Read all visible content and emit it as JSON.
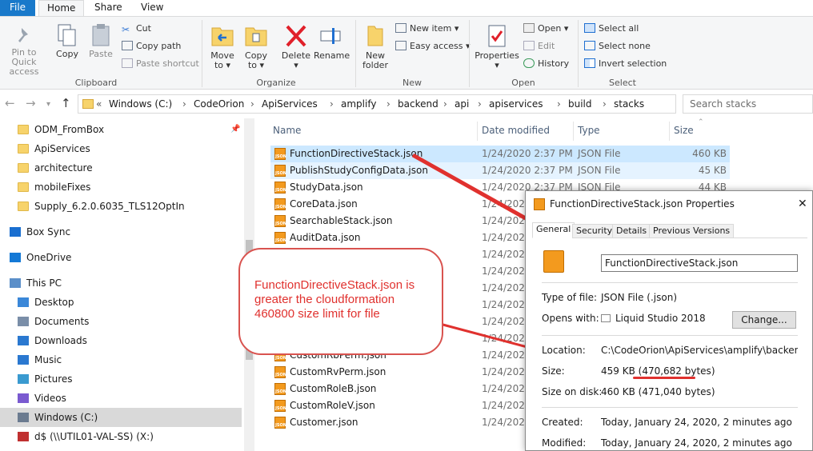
{
  "tabs": {
    "file": "File",
    "home": "Home",
    "share": "Share",
    "view": "View"
  },
  "ribbon": {
    "pin": "Pin to Quick access",
    "copy": "Copy",
    "paste": "Paste",
    "cut": "Cut",
    "copy_path": "Copy path",
    "paste_shortcut": "Paste shortcut",
    "move_to": "Move to ▾",
    "copy_to": "Copy to ▾",
    "delete": "Delete ▾",
    "rename": "Rename",
    "new_folder": "New folder",
    "new_item": "New item ▾",
    "easy_access": "Easy access ▾",
    "properties": "Properties ▾",
    "open": "Open ▾",
    "edit": "Edit",
    "history": "History",
    "select_all": "Select all",
    "select_none": "Select none",
    "invert_selection": "Invert selection",
    "groups": {
      "clipboard": "Clipboard",
      "organize": "Organize",
      "new": "New",
      "open": "Open",
      "select": "Select"
    }
  },
  "address": {
    "prefix": "«",
    "crumbs": [
      "Windows (C:)",
      "CodeOrion",
      "ApiServices",
      "amplify",
      "backend",
      "api",
      "apiservices",
      "build",
      "stacks"
    ],
    "search_placeholder": "Search stacks"
  },
  "nav": {
    "items": [
      {
        "label": "ODM_FromBox",
        "icon": "folder-icon"
      },
      {
        "label": "ApiServices",
        "icon": "folder-icon"
      },
      {
        "label": "architecture",
        "icon": "folder-icon"
      },
      {
        "label": "mobileFixes",
        "icon": "folder-icon"
      },
      {
        "label": "Supply_6.2.0.6035_TLS12OptIn",
        "icon": "folder-icon"
      },
      {
        "label": "Box Sync",
        "icon": "box-icon"
      },
      {
        "label": "OneDrive",
        "icon": "cloud-icon"
      },
      {
        "label": "This PC",
        "icon": "computer-icon"
      },
      {
        "label": "Desktop",
        "icon": "desktop-icon"
      },
      {
        "label": "Documents",
        "icon": "documents-icon"
      },
      {
        "label": "Downloads",
        "icon": "download-icon"
      },
      {
        "label": "Music",
        "icon": "music-icon"
      },
      {
        "label": "Pictures",
        "icon": "pictures-icon"
      },
      {
        "label": "Videos",
        "icon": "videos-icon"
      },
      {
        "label": "Windows (C:)",
        "icon": "drive-icon"
      },
      {
        "label": "d$ (\\\\UTIL01-VAL-SS) (X:)",
        "icon": "network-drive-icon"
      }
    ]
  },
  "files": {
    "headers": {
      "name": "Name",
      "date": "Date modified",
      "type": "Type",
      "size": "Size"
    },
    "rows": [
      {
        "name": "FunctionDirectiveStack.json",
        "date": "1/24/2020 2:37 PM",
        "type": "JSON File",
        "size": "460 KB"
      },
      {
        "name": "PublishStudyConfigData.json",
        "date": "1/24/2020 2:37 PM",
        "type": "JSON File",
        "size": "45 KB"
      },
      {
        "name": "StudyData.json",
        "date": "1/24/2020 2:37 PM",
        "type": "JSON File",
        "size": "44 KB"
      },
      {
        "name": "CoreData.json",
        "date": "1/24/2020 2:37 PM",
        "type": "",
        "size": ""
      },
      {
        "name": "SearchableStack.json",
        "date": "1/24/2020 2:37 PM",
        "type": "",
        "size": ""
      },
      {
        "name": "AuditData.json",
        "date": "1/24/2020 2:37 PM",
        "type": "",
        "size": ""
      },
      {
        "name": "",
        "date": "1/24/2020 2:37 PM",
        "type": "",
        "size": ""
      },
      {
        "name": "",
        "date": "1/24/2020 2:37 PM",
        "type": "",
        "size": ""
      },
      {
        "name": "",
        "date": "1/24/2020 2:37 PM",
        "type": "",
        "size": ""
      },
      {
        "name": "",
        "date": "1/24/2020 2:37 PM",
        "type": "",
        "size": ""
      },
      {
        "name": "",
        "date": "1/24/2020 2:37 PM",
        "type": "",
        "size": ""
      },
      {
        "name": "CustomUserStudy.json",
        "date": "1/24/2020 2:37 PM",
        "type": "",
        "size": ""
      },
      {
        "name": "CustomRbPerm.json",
        "date": "1/24/2020 2:37 PM",
        "type": "",
        "size": ""
      },
      {
        "name": "CustomRvPerm.json",
        "date": "1/24/2020 2:37 PM",
        "type": "",
        "size": ""
      },
      {
        "name": "CustomRoleB.json",
        "date": "1/24/2020 2:37 PM",
        "type": "",
        "size": ""
      },
      {
        "name": "CustomRoleV.json",
        "date": "1/24/2020 2:37 PM",
        "type": "",
        "size": ""
      },
      {
        "name": "Customer.json",
        "date": "1/24/2020 2:37 PM",
        "type": "",
        "size": ""
      }
    ]
  },
  "dialog": {
    "title": "FunctionDirectiveStack.json Properties",
    "close": "✕",
    "tabs": [
      "General",
      "Security",
      "Details",
      "Previous Versions"
    ],
    "filename": "FunctionDirectiveStack.json",
    "type_label": "Type of file:",
    "type_value": "JSON File (.json)",
    "opens_label": "Opens with:",
    "opens_value": "Liquid Studio 2018",
    "change_button": "Change...",
    "location_label": "Location:",
    "location_value": "C:\\CodeOrion\\ApiServices\\amplify\\backend\\api\\ap",
    "size_label": "Size:",
    "size_value": "459 KB (470,682 bytes)",
    "sizeondisk_label": "Size on disk:",
    "sizeondisk_value": "460 KB (471,040 bytes)",
    "created_label": "Created:",
    "created_value": "Today, January 24, 2020, 2 minutes ago",
    "modified_label": "Modified:",
    "modified_value": "Today, January 24, 2020, 2 minutes ago"
  },
  "callout": {
    "text": "FunctionDirectiveStack.json is greater the cloudformation 460800 size limit for file"
  },
  "colors": {
    "accent": "#1979ca",
    "selection": "#cce8ff",
    "annotation": "#e0312e"
  }
}
